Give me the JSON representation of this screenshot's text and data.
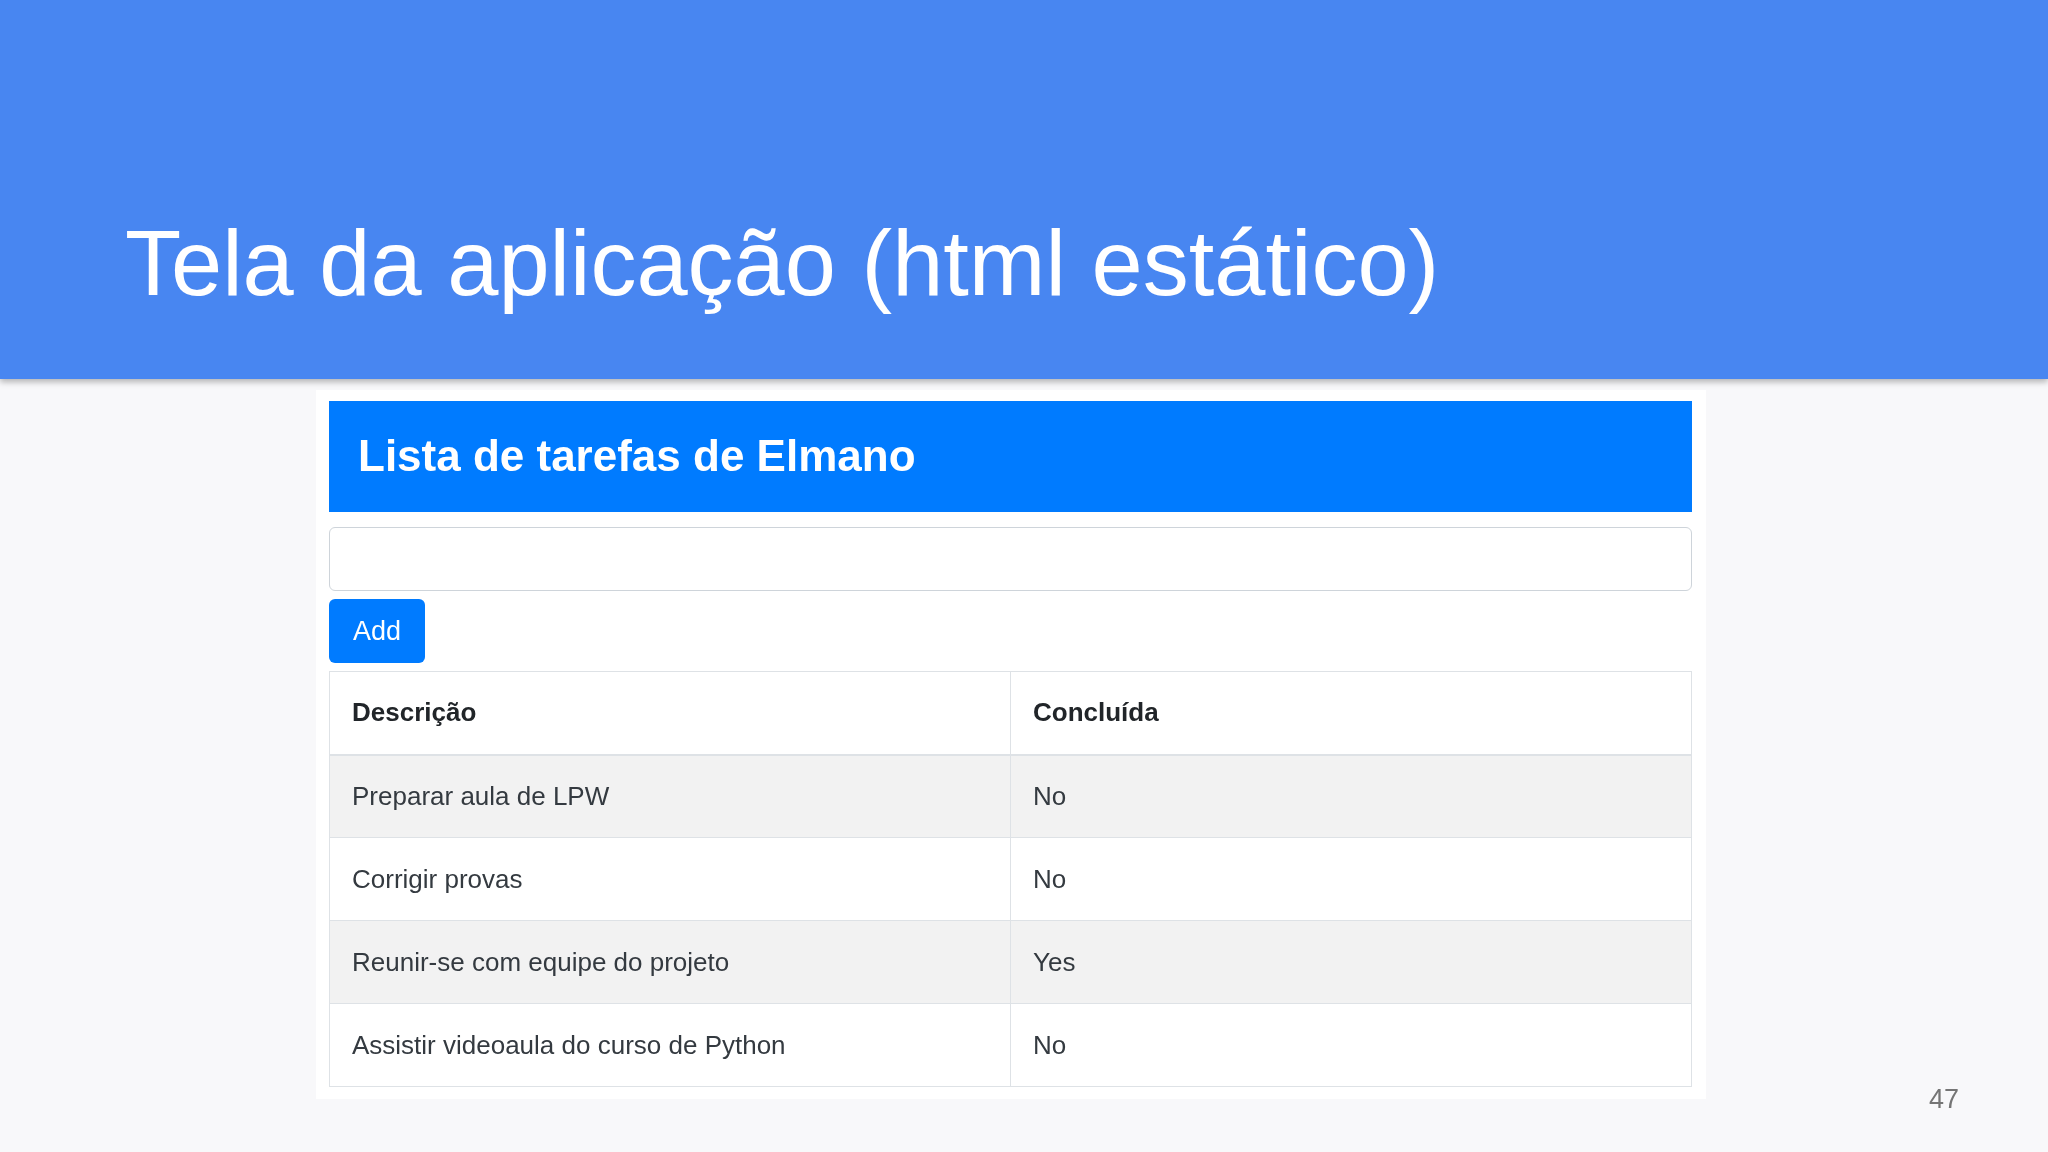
{
  "slide": {
    "title": "Tela da aplicação (html estático)",
    "page_number": "47"
  },
  "app": {
    "heading": "Lista de tarefas de Elmano",
    "add_button": "Add",
    "table": {
      "columns": [
        "Descrição",
        "Concluída"
      ],
      "rows": [
        {
          "description": "Preparar aula de LPW",
          "done": "No"
        },
        {
          "description": "Corrigir provas",
          "done": "No"
        },
        {
          "description": "Reunir-se com equipe do projeto",
          "done": "Yes"
        },
        {
          "description": "Assistir videoaula do curso de Python",
          "done": "No"
        }
      ]
    }
  }
}
